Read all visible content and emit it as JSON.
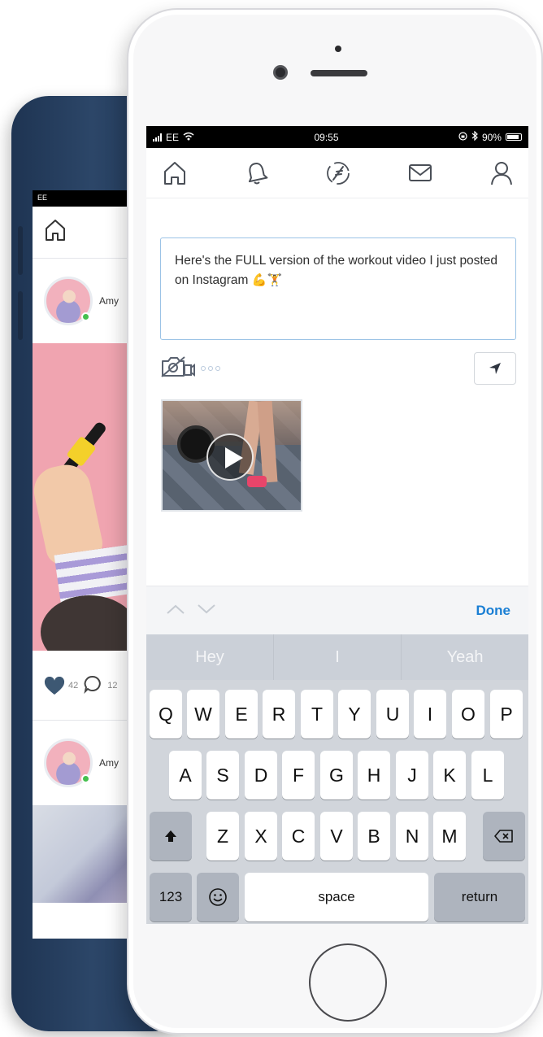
{
  "back_phone": {
    "user_name": "Amy",
    "likes": "42",
    "comments": "12"
  },
  "status_bar": {
    "carrier": "EE",
    "time": "09:55",
    "battery": "90%"
  },
  "nav": {
    "icons": [
      "home-icon",
      "bell-icon",
      "feather-icon",
      "mail-icon",
      "user-icon"
    ]
  },
  "compose": {
    "text": "Here's the FULL version of the workout video I just posted on Instagram",
    "emojis": "💪🏋"
  },
  "accessory_bar": {
    "done_label": "Done"
  },
  "keyboard": {
    "suggestions": [
      "Hey",
      "I",
      "Yeah"
    ],
    "row1": [
      "Q",
      "W",
      "E",
      "R",
      "T",
      "Y",
      "U",
      "I",
      "O",
      "P"
    ],
    "row2": [
      "A",
      "S",
      "D",
      "F",
      "G",
      "H",
      "J",
      "K",
      "L"
    ],
    "row3": [
      "Z",
      "X",
      "C",
      "V",
      "B",
      "N",
      "M"
    ],
    "numbers_label": "123",
    "space_label": "space",
    "return_label": "return"
  }
}
